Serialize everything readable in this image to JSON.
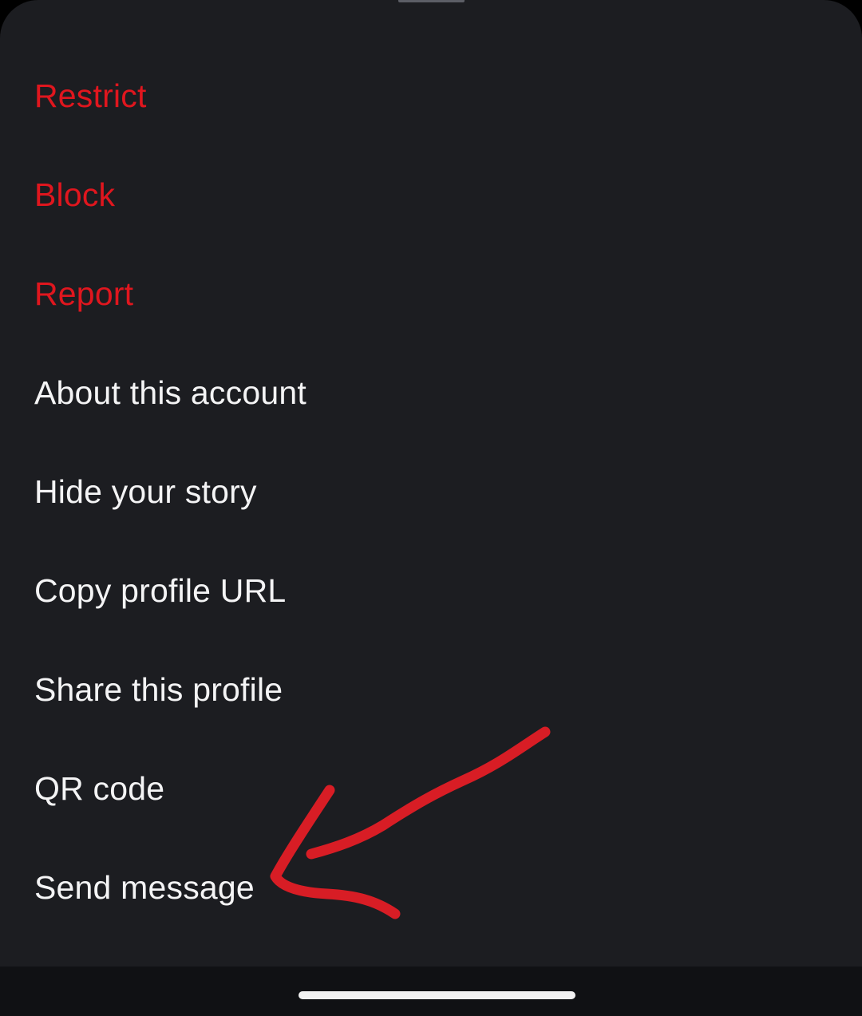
{
  "menu": {
    "items": [
      {
        "label": "Restrict",
        "style": "danger"
      },
      {
        "label": "Block",
        "style": "danger"
      },
      {
        "label": "Report",
        "style": "danger"
      },
      {
        "label": "About this account",
        "style": "normal"
      },
      {
        "label": "Hide your story",
        "style": "normal"
      },
      {
        "label": "Copy profile URL",
        "style": "normal"
      },
      {
        "label": "Share this profile",
        "style": "normal"
      },
      {
        "label": "QR code",
        "style": "normal"
      },
      {
        "label": "Send message",
        "style": "normal"
      }
    ]
  },
  "colors": {
    "sheet_background": "#1c1d21",
    "danger_text": "#e0161e",
    "normal_text": "#f4f4f5",
    "annotation_arrow": "#d81d25"
  },
  "annotation": {
    "icon": "hand-drawn-arrow-icon",
    "points_to": "Send message"
  }
}
